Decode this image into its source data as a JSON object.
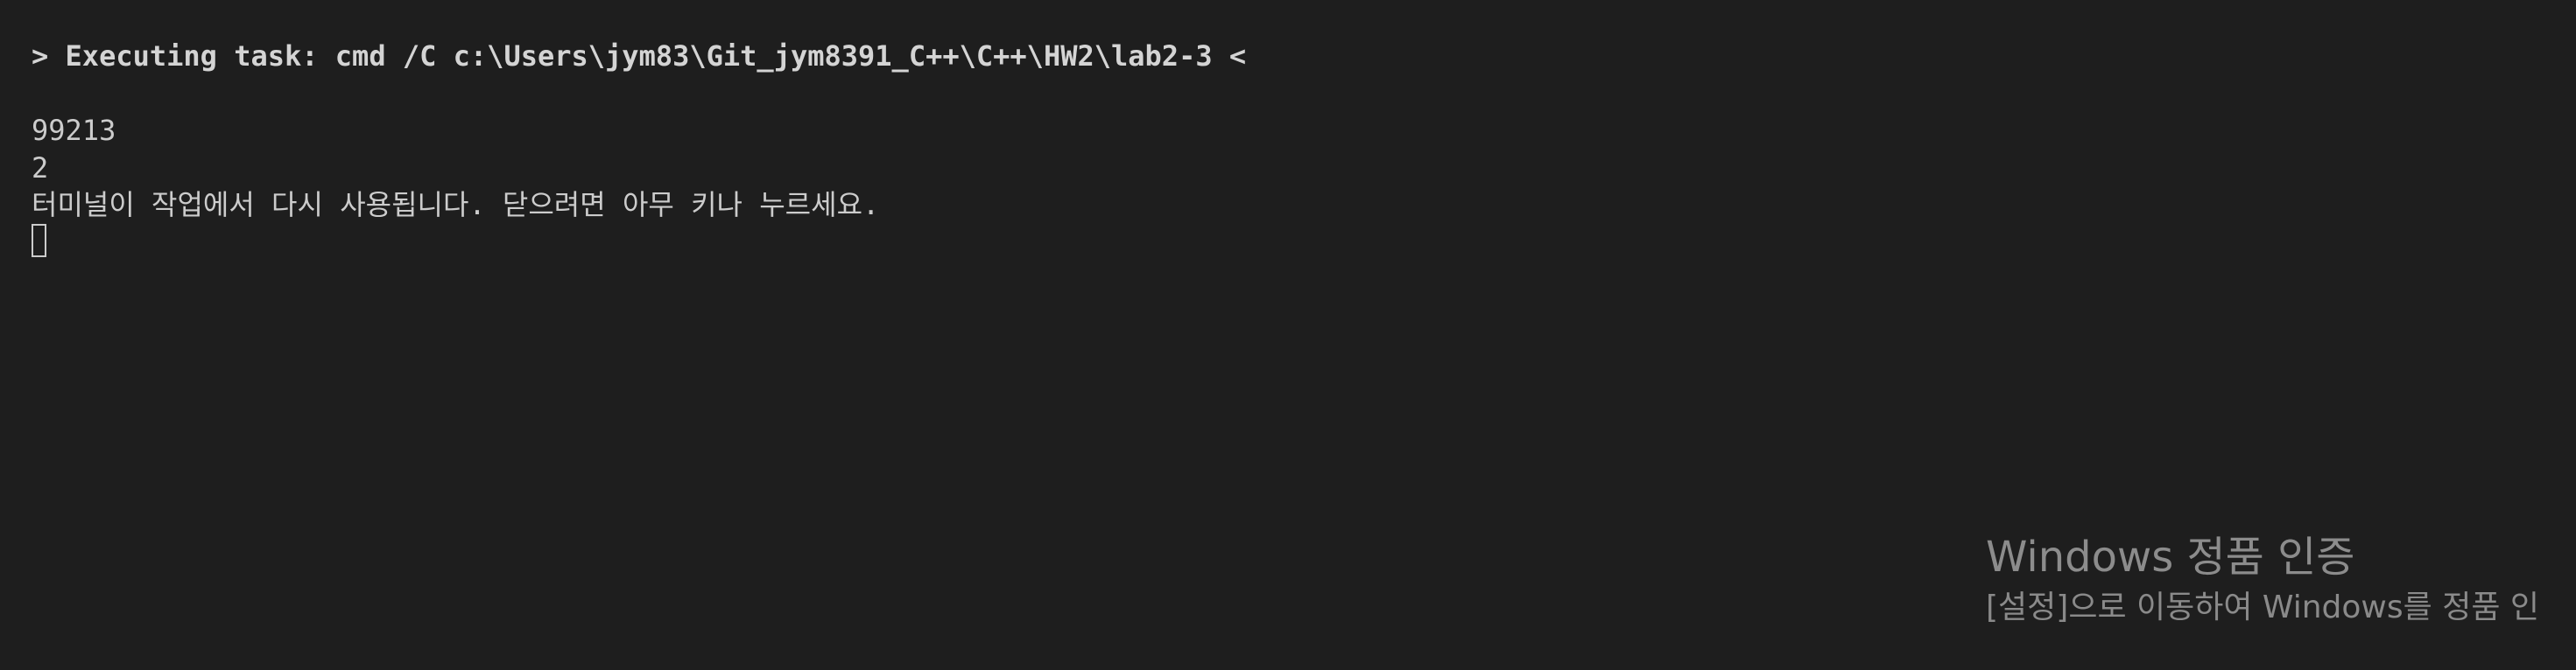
{
  "terminal": {
    "task_line": "> Executing task: cmd /C c:\\Users\\jym83\\Git_jym8391_C++\\C++\\HW2\\lab2-3 <",
    "output": [
      "99213",
      "2",
      "터미널이 작업에서 다시 사용됩니다. 닫으려면 아무 키나 누르세요."
    ]
  },
  "watermark": {
    "title": "Windows 정품 인증",
    "subtitle": "[설정]으로 이동하여 Windows를 정품 인"
  },
  "colors": {
    "background": "#1e1e1e",
    "text": "#cccccc",
    "watermark": "#8a8a8a"
  }
}
